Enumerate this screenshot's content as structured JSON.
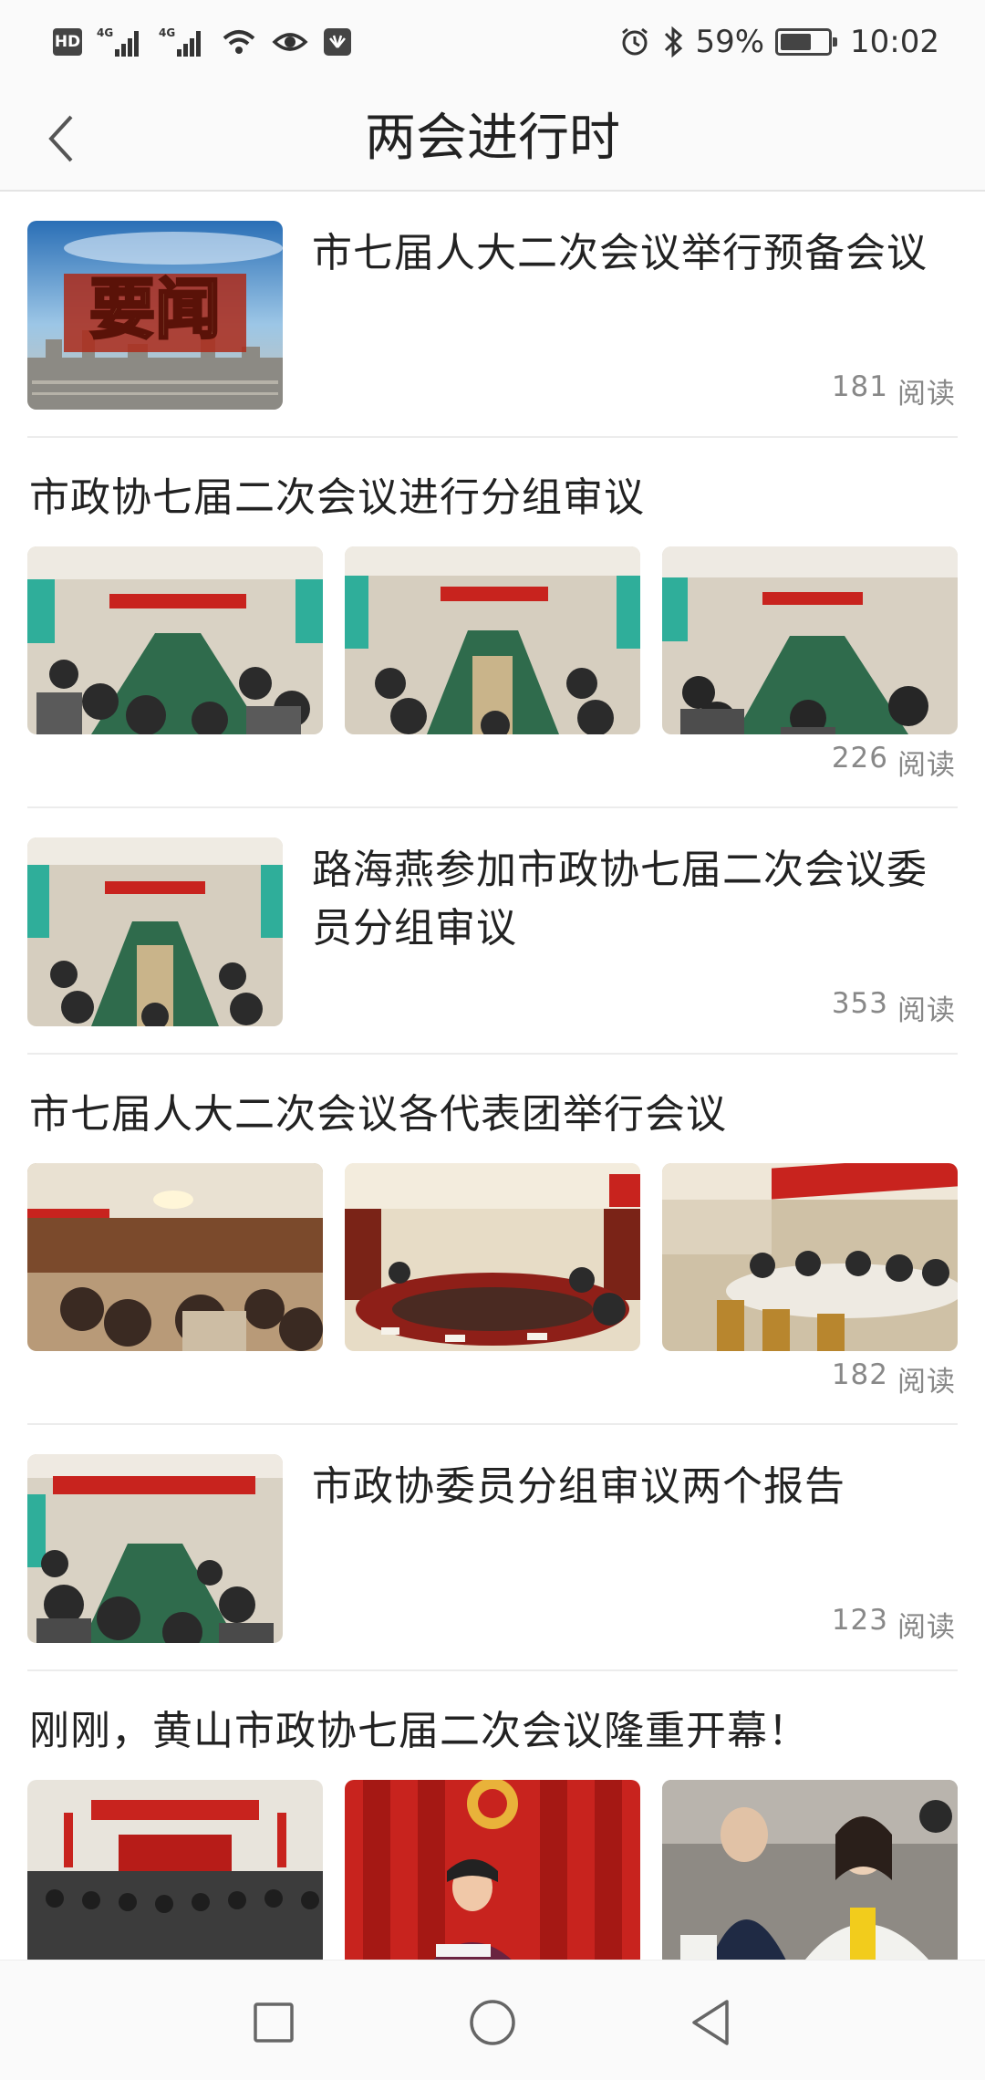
{
  "status_bar": {
    "left_icons": [
      "hd-icon",
      "signal-4g-icon",
      "signal-4g-icon",
      "wifi-icon",
      "eye-icon",
      "huawei-app-icon"
    ],
    "hd": "HD",
    "net1": "4G",
    "net2": "4G",
    "battery": "59%",
    "battery_level": 0.59,
    "time": "10:02"
  },
  "header": {
    "back_icon": "chevron-left-icon",
    "title": "两会进行时"
  },
  "articles": [
    {
      "title": "市七届人大二次会议举行预备会议",
      "count": "181",
      "read_label": "阅读",
      "thumb_text": "要闻"
    },
    {
      "title": "市政协七届二次会议进行分组审议",
      "count": "226",
      "read_label": "阅读"
    },
    {
      "title": "路海燕参加市政协七届二次会议委员分组审议",
      "count": "353",
      "read_label": "阅读"
    },
    {
      "title": "市七届人大二次会议各代表团举行会议",
      "count": "182",
      "read_label": "阅读"
    },
    {
      "title": "市政协委员分组审议两个报告",
      "count": "123",
      "read_label": "阅读"
    },
    {
      "title": "刚刚，黄山市政协七届二次会议隆重开幕！"
    }
  ],
  "nav": {
    "icons": [
      "recent-apps-icon",
      "home-icon",
      "back-triangle-icon"
    ]
  },
  "colors": {
    "banner_red": "#c8231e",
    "table_green": "#2f6b4c",
    "text": "#222222",
    "muted": "#888888"
  }
}
